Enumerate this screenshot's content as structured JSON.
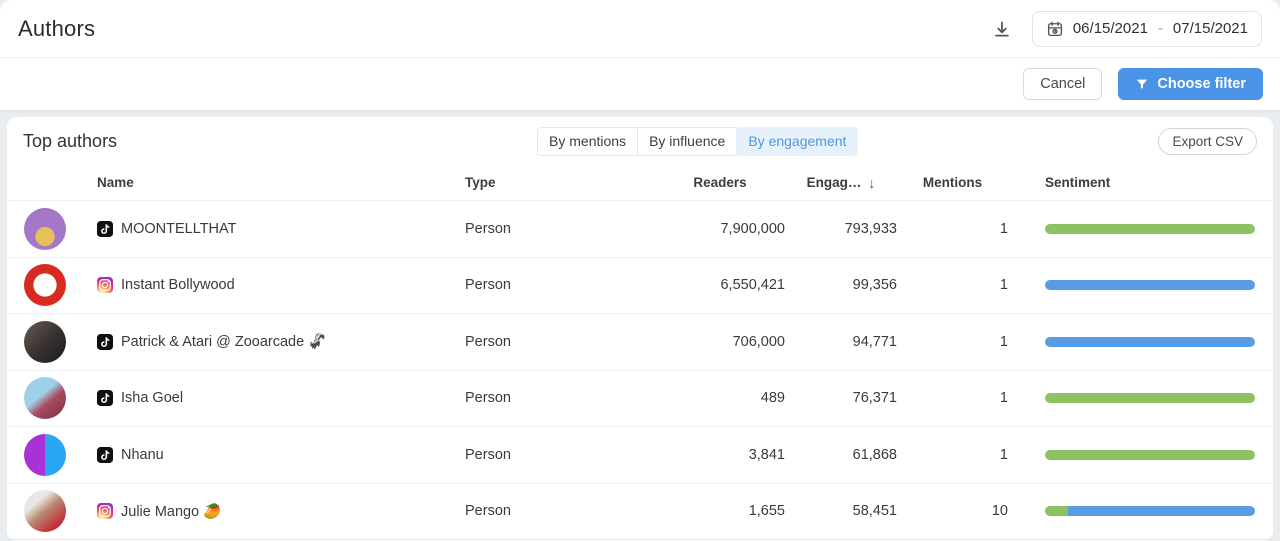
{
  "header": {
    "title": "Authors",
    "date_range": {
      "start": "06/15/2021",
      "separator": "-",
      "end": "07/15/2021"
    }
  },
  "toolbar": {
    "cancel_label": "Cancel",
    "choose_filter_label": "Choose filter"
  },
  "panel": {
    "title": "Top authors",
    "tabs": [
      {
        "label": "By mentions",
        "active": false
      },
      {
        "label": "By influence",
        "active": false
      },
      {
        "label": "By engagement",
        "active": true
      }
    ],
    "export_label": "Export CSV",
    "columns": {
      "name": "Name",
      "type": "Type",
      "readers": "Readers",
      "engagement": "Engag…",
      "sort_icon": "↓",
      "mentions": "Mentions",
      "sentiment": "Sentiment"
    },
    "rows": [
      {
        "platform": "tiktok",
        "name": "MOONTELLTHAT",
        "type": "Person",
        "readers": "7,900,000",
        "engagement": "793,933",
        "mentions": "1",
        "sentiment": [
          {
            "kind": "positive",
            "pct": 100
          }
        ]
      },
      {
        "platform": "instagram",
        "name": "Instant Bollywood",
        "type": "Person",
        "readers": "6,550,421",
        "engagement": "99,356",
        "mentions": "1",
        "sentiment": [
          {
            "kind": "neutral",
            "pct": 100
          }
        ]
      },
      {
        "platform": "tiktok",
        "name": "Patrick & Atari @ Zooarcade 🦨",
        "type": "Person",
        "readers": "706,000",
        "engagement": "94,771",
        "mentions": "1",
        "sentiment": [
          {
            "kind": "neutral",
            "pct": 100
          }
        ]
      },
      {
        "platform": "tiktok",
        "name": "Isha Goel",
        "type": "Person",
        "readers": "489",
        "engagement": "76,371",
        "mentions": "1",
        "sentiment": [
          {
            "kind": "positive",
            "pct": 100
          }
        ]
      },
      {
        "platform": "tiktok",
        "name": "Nhanu",
        "type": "Person",
        "readers": "3,841",
        "engagement": "61,868",
        "mentions": "1",
        "sentiment": [
          {
            "kind": "positive",
            "pct": 100
          }
        ]
      },
      {
        "platform": "instagram",
        "name": "Julie Mango 🥭",
        "type": "Person",
        "readers": "1,655",
        "engagement": "58,451",
        "mentions": "10",
        "sentiment": [
          {
            "kind": "positive",
            "pct": 11
          },
          {
            "kind": "neutral",
            "pct": 89
          }
        ]
      }
    ]
  },
  "colors": {
    "sentiment_positive": "#8dc262",
    "sentiment_neutral": "#579ce5",
    "accent_blue": "#4b93e6",
    "active_tab_bg": "#e7f1fc",
    "active_tab_text": "#4a97e4"
  }
}
